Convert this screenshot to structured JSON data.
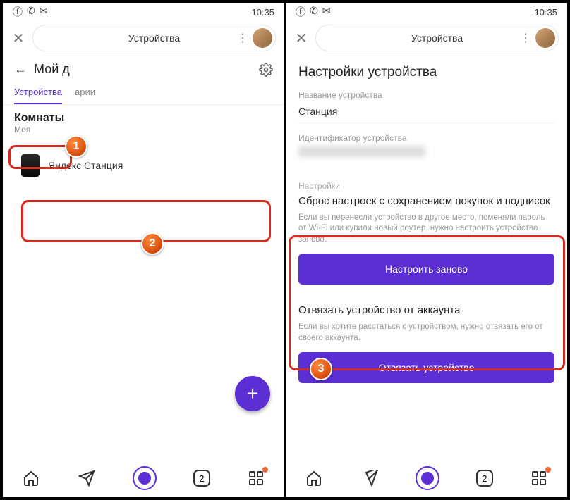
{
  "status": {
    "time": "10:35"
  },
  "header": {
    "title": "Устройства"
  },
  "left": {
    "section_title": "Мой д",
    "tabs": {
      "devices": "Устройства",
      "scenarios": "арии"
    },
    "rooms_label": "Комнаты",
    "rooms_sub": "Моя",
    "device_name": "Яндекс Станция",
    "fab": "+",
    "nav_count": "2"
  },
  "right": {
    "page_title": "Настройки устройства",
    "name_label": "Название устройства",
    "name_value": "Станция",
    "id_label": "Идентификатор устройства",
    "settings_label": "Настройки",
    "reset_title": "Сброс настроек с сохранением покупок и подписок",
    "reset_desc": "Если вы перенесли устройство в другое место, поменяли пароль от Wi-Fi или купили новый роутер, нужно настроить устройство заново.",
    "reset_btn": "Настроить заново",
    "unlink_title": "Отвязать устройство от аккаунта",
    "unlink_desc": "Если вы хотите расстаться с устройством, нужно отвязать его от своего аккаунта.",
    "unlink_btn": "Отвязать устройство",
    "nav_count": "2"
  },
  "markers": {
    "one": "1",
    "two": "2",
    "three": "3"
  }
}
